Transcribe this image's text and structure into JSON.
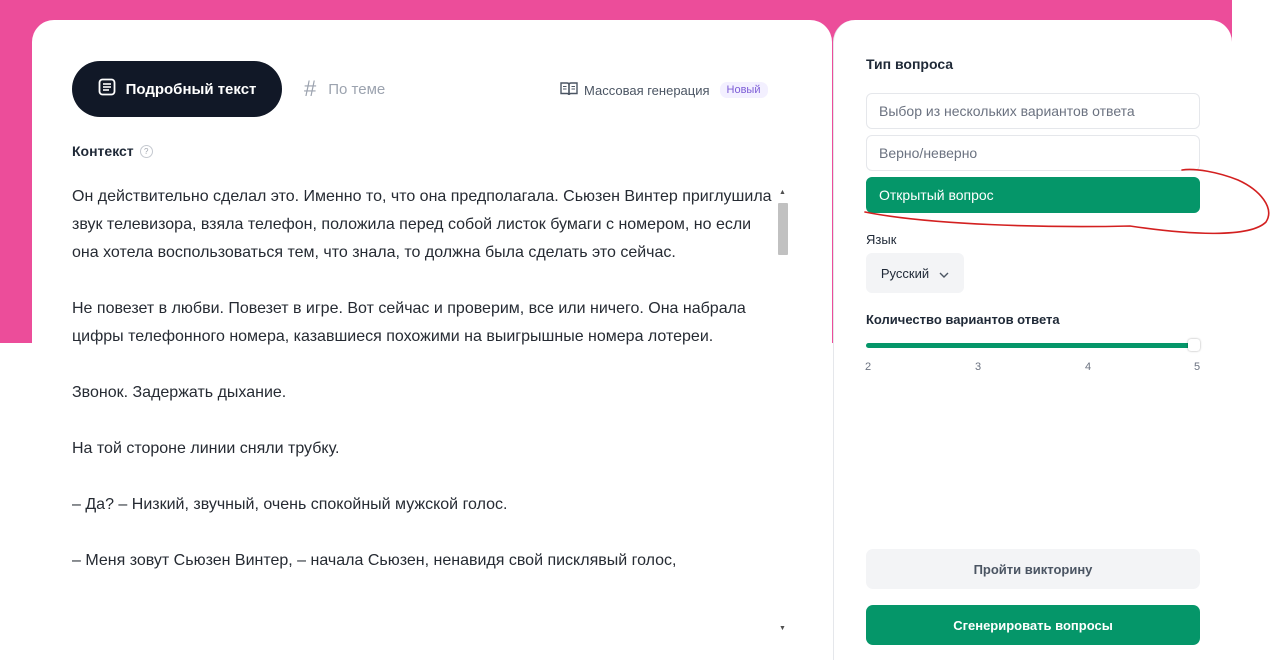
{
  "colors": {
    "accent": "#059669",
    "background_pink": "#ec4d9a",
    "tab_active_bg": "#111827",
    "annotation_red": "#d32020"
  },
  "tabs": {
    "detailed_text": "Подробный текст",
    "by_topic": "По теме",
    "detailed_text_icon": "document-list-icon",
    "by_topic_icon": "hash-icon"
  },
  "mass_generation": {
    "label": "Массовая генерация",
    "badge": "Новый",
    "icon": "book-open-icon"
  },
  "context": {
    "label": "Контекст",
    "help_icon": "question-circle-icon",
    "paragraphs": [
      "Он действительно сделал это. Именно то, что она предполагала. Сьюзен Винтер приглушила звук телевизора, взяла телефон, положила перед собой листок бумаги с номером, но если она хотела воспользоваться тем, что знала, то должна была сделать это сейчас.",
      "Не повезет в любви. Повезет в игре. Вот сейчас и проверим, все или ничего. Она набрала цифры телефонного номера, казавшиеся похожими на выигрышные номера лотереи.",
      "Звонок. Задержать дыхание.",
      "На той стороне линии сняли трубку.",
      "– Да? – Низкий, звучный, очень спокойный мужской голос.",
      "– Меня зовут Сьюзен Винтер, – начала Сьюзен, ненавидя свой писклявый голос,"
    ]
  },
  "question_type": {
    "label": "Тип вопроса",
    "options": [
      {
        "label": "Выбор из нескольких вариантов ответа",
        "selected": false
      },
      {
        "label": "Верно/неверно",
        "selected": false
      },
      {
        "label": "Открытый вопрос",
        "selected": true
      }
    ]
  },
  "language": {
    "label": "Язык",
    "selected": "Русский",
    "icon": "chevron-down-icon"
  },
  "answer_count": {
    "label": "Количество вариантов ответа",
    "min": 2,
    "max": 5,
    "value": 5,
    "ticks": [
      "2",
      "3",
      "4",
      "5"
    ]
  },
  "buttons": {
    "take_quiz": "Пройти викторину",
    "generate": "Сгенерировать вопросы"
  }
}
